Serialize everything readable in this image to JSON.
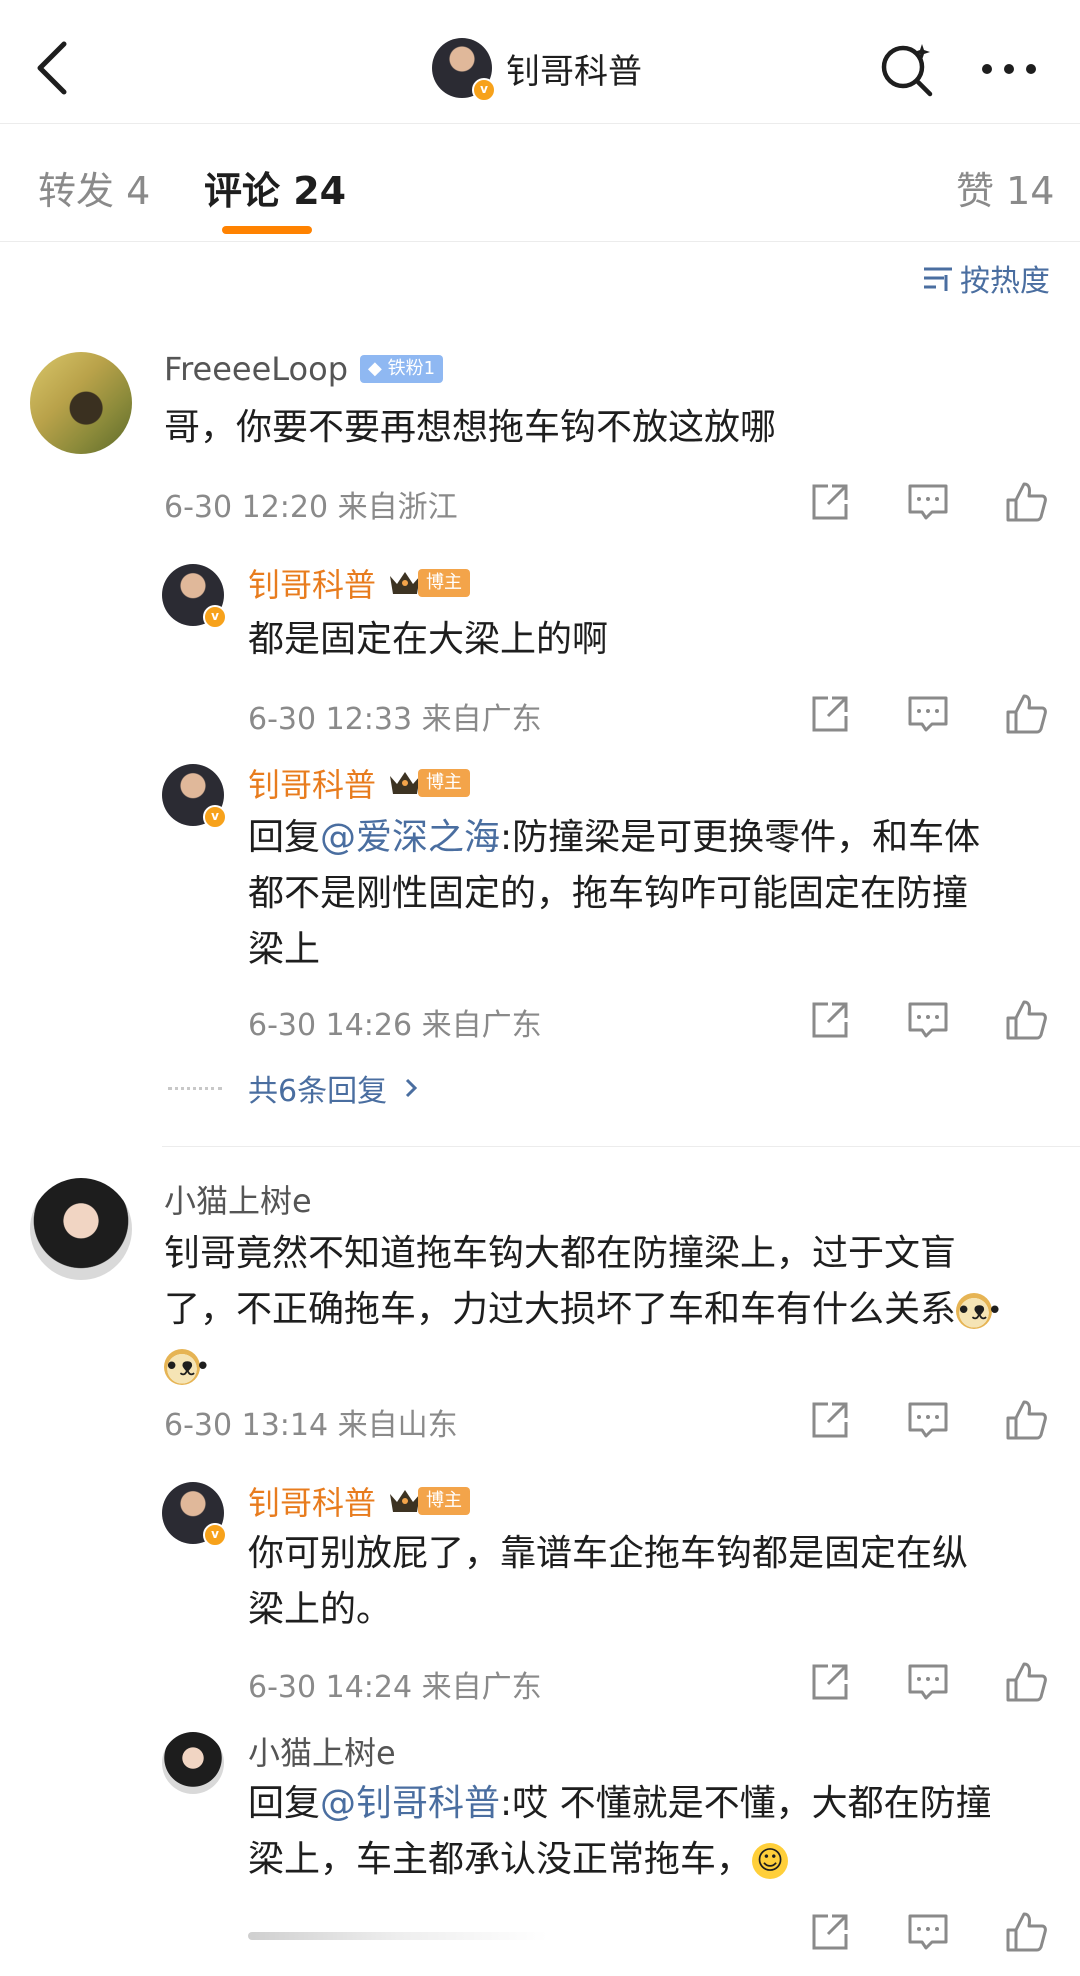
{
  "header": {
    "title": "钊哥科普"
  },
  "tabs": [
    {
      "label": "转发 4"
    },
    {
      "label": "评论 24"
    },
    {
      "label": "赞 14"
    }
  ],
  "sort_label": "按热度",
  "colors": {
    "accent": "#ff8200",
    "link": "#4a6ea0",
    "blogger_name": "#e87c1e"
  },
  "comments": [
    {
      "user": "FreeeeLoop",
      "badge": "铁粉1",
      "text": "哥，你要不要再想想拖车钩不放这放哪",
      "meta": "6-30 12:20  来自浙江",
      "replies": [
        {
          "user": "钊哥科普",
          "badge": "博主",
          "text": "都是固定在大梁上的啊",
          "meta": "6-30 12:33  来自广东"
        },
        {
          "user": "钊哥科普",
          "badge": "博主",
          "reply_prefix": "回复",
          "mention": "@爱深之海",
          "text_line1": ":防撞梁是可更换零件，和车体",
          "text_line2": "都不是刚性固定的，拖车钩咋可能固定在防撞",
          "text_line3": "梁上",
          "meta": "6-30 14:26  来自广东"
        }
      ],
      "more_replies": "共6条回复"
    },
    {
      "user": "小猫上树e",
      "text_line1": "钊哥竟然不知道拖车钩大都在防撞梁上，过于文盲",
      "text_line2": "了，不正确拖车，力过大损坏了车和车有什么关系",
      "meta": "6-30 13:14  来自山东",
      "replies": [
        {
          "user": "钊哥科普",
          "badge": "博主",
          "text_line1": "你可别放屁了，靠谱车企拖车钩都是固定在纵",
          "text_line2": "梁上的。",
          "meta": "6-30 14:24  来自广东"
        },
        {
          "user": "小猫上树e",
          "reply_prefix": "回复",
          "mention": "@钊哥科普",
          "text_line1": ":哎  不懂就是不懂，大都在防撞",
          "text_line2": "梁上，车主都承认没正常拖车，"
        }
      ]
    }
  ]
}
